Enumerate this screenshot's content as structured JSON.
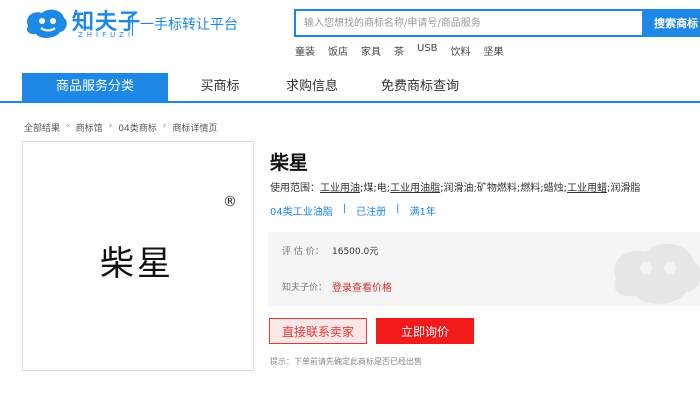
{
  "header": {
    "logo_text": "知夫子",
    "logo_sub": "ZHIFUZI",
    "slogan": "一手标转让平台",
    "search_placeholder": "输入您想找的商标名称/申请号/商品服务",
    "search_button": "搜索商标",
    "hot_tags": [
      "童装",
      "饭店",
      "家具",
      "茶",
      "USB",
      "饮料",
      "坚果"
    ]
  },
  "nav": {
    "items": [
      {
        "label": "商品服务分类",
        "active": true
      },
      {
        "label": "买商标",
        "active": false
      },
      {
        "label": "求购信息",
        "active": false
      },
      {
        "label": "免费商标查询",
        "active": false
      }
    ]
  },
  "breadcrumb": [
    "全部结果",
    "商标馆",
    "04类商标",
    "商标详情页"
  ],
  "breadcrumb_sep": "›",
  "trademark": {
    "image_text": "柴星",
    "registered_mark": "®",
    "name": "柴星",
    "scope_label": "使用范围：",
    "scope_items": [
      {
        "text": "工业用油",
        "underline": true
      },
      {
        "text": ";煤;电;",
        "underline": false
      },
      {
        "text": "工业用油脂",
        "underline": true
      },
      {
        "text": ";润滑油;矿物燃料;燃料;蜡烛;",
        "underline": false
      },
      {
        "text": "工业用蜡",
        "underline": true
      },
      {
        "text": ";润滑脂",
        "underline": false
      }
    ],
    "class_label": "04类工业油脂",
    "status": "已注册",
    "age": "满1年",
    "meta_sep": "|"
  },
  "price": {
    "estimate_label": "评 估 价：",
    "estimate_value": "16500.0元",
    "zhifuzi_label": "知夫子价：",
    "login_text": "登录查看价格"
  },
  "actions": {
    "contact": "直接联系卖家",
    "inquiry": "立即询价"
  },
  "hint": "提示：下单前请先确定此商标是否已经出售",
  "colors": {
    "brand_blue": "#1e88e5",
    "accent_red": "#f21b1b"
  }
}
